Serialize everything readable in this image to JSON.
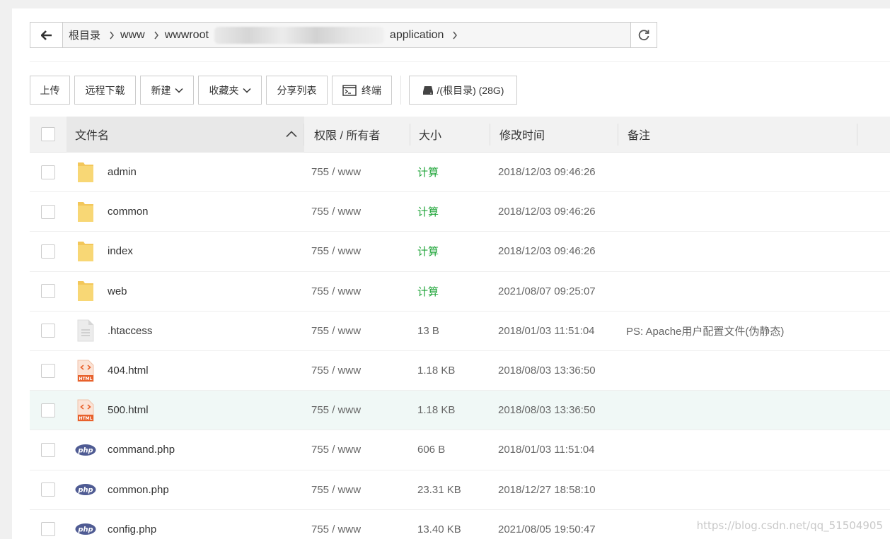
{
  "pathbar": {
    "crumbs": [
      "根目录",
      "www",
      "wwwroot",
      "application"
    ]
  },
  "toolbar": {
    "upload": "上传",
    "remote_download": "远程下载",
    "new": "新建",
    "favorites": "收藏夹",
    "share_list": "分享列表",
    "terminal": "终端",
    "disk": "/(根目录) (28G)"
  },
  "table": {
    "headers": {
      "name": "文件名",
      "perm": "权限 / 所有者",
      "size": "大小",
      "mtime": "修改时间",
      "note": "备注"
    },
    "rows": [
      {
        "icon": "folder-icon",
        "name": "admin",
        "perm": "755 / www",
        "size": "计算",
        "mtime": "2018/12/03 09:46:26",
        "note": ""
      },
      {
        "icon": "folder-icon",
        "name": "common",
        "perm": "755 / www",
        "size": "计算",
        "mtime": "2018/12/03 09:46:26",
        "note": ""
      },
      {
        "icon": "folder-icon",
        "name": "index",
        "perm": "755 / www",
        "size": "计算",
        "mtime": "2018/12/03 09:46:26",
        "note": ""
      },
      {
        "icon": "folder-icon",
        "name": "web",
        "perm": "755 / www",
        "size": "计算",
        "mtime": "2021/08/07 09:25:07",
        "note": ""
      },
      {
        "icon": "text-file-icon",
        "name": ".htaccess",
        "perm": "755 / www",
        "size": "13 B",
        "mtime": "2018/01/03 11:51:04",
        "note": "PS: Apache用户配置文件(伪静态)"
      },
      {
        "icon": "html-file-icon",
        "name": "404.html",
        "perm": "755 / www",
        "size": "1.18 KB",
        "mtime": "2018/08/03 13:36:50",
        "note": ""
      },
      {
        "icon": "html-file-icon",
        "name": "500.html",
        "perm": "755 / www",
        "size": "1.18 KB",
        "mtime": "2018/08/03 13:36:50",
        "note": ""
      },
      {
        "icon": "php-file-icon",
        "name": "command.php",
        "perm": "755 / www",
        "size": "606 B",
        "mtime": "2018/01/03 11:51:04",
        "note": ""
      },
      {
        "icon": "php-file-icon",
        "name": "common.php",
        "perm": "755 / www",
        "size": "23.31 KB",
        "mtime": "2018/12/27 18:58:10",
        "note": ""
      },
      {
        "icon": "php-file-icon",
        "name": "config.php",
        "perm": "755 / www",
        "size": "13.40 KB",
        "mtime": "2021/08/05 19:50:47",
        "note": ""
      }
    ]
  },
  "watermark": "https://blog.csdn.net/qq_51504905",
  "colors": {
    "calc_link": "#20a53a",
    "folder": "#f8d775",
    "php_badge": "#4f5b93",
    "html_badge": "#e8612c",
    "highlight_row": "#f0f8f6"
  }
}
